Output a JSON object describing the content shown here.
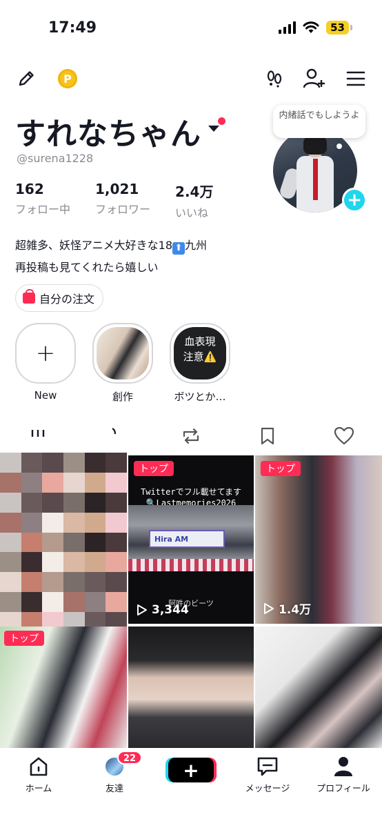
{
  "status_bar": {
    "time": "17:49",
    "battery": "53"
  },
  "top_nav": {
    "coin_symbol": "P"
  },
  "profile": {
    "display_name": "すれなちゃん",
    "handle": "@surena1228",
    "note_bubble": "内緒話でもしようよ",
    "stats": [
      {
        "value": "162",
        "label": "フォロー中"
      },
      {
        "value": "1,021",
        "label": "フォロワー"
      },
      {
        "value": "2.4万",
        "label": "いいね"
      }
    ],
    "bio_line1_prefix": "超雑多、妖怪アニメ大好きな18",
    "bio_line1_emoji": "⬆",
    "bio_line1_suffix": "九州",
    "bio_line2": "再投稿も見てくれたら嬉しい",
    "order_button": "自分の注文"
  },
  "highlights": [
    {
      "label": "New",
      "icon": "plus-icon"
    },
    {
      "label": "創作",
      "icon": "photo"
    },
    {
      "label": "ボツとか…",
      "icon": "photo",
      "overlay_line1": "血表現",
      "overlay_line2": "注意⚠️"
    }
  ],
  "tabs": [
    {
      "icon": "grid-icon"
    },
    {
      "icon": "lock-icon"
    },
    {
      "icon": "repost-icon"
    },
    {
      "icon": "bookmark-icon"
    },
    {
      "icon": "heart-icon"
    }
  ],
  "videos": [
    {
      "pinned": "",
      "views": ""
    },
    {
      "pinned": "トップ",
      "views": "3,344",
      "caption_top": "Twitterでフル載せてます",
      "caption_tag": "🔍Lastmemories2026",
      "caption_bottom": "阿吽のビーツ",
      "stage_text": "Hira AM"
    },
    {
      "pinned": "トップ",
      "views": "1.4万"
    },
    {
      "pinned": "トップ",
      "views": ""
    },
    {
      "pinned": "",
      "views": ""
    },
    {
      "pinned": "",
      "views": ""
    }
  ],
  "bottom_nav": {
    "home": "ホーム",
    "friends": "友達",
    "friends_badge": "22",
    "create": "+",
    "inbox": "メッセージ",
    "profile": "プロフィール"
  },
  "colors": {
    "accent": "#fe2c55",
    "cyan": "#20d5ec",
    "text": "#161823",
    "muted": "#8a8b91"
  }
}
